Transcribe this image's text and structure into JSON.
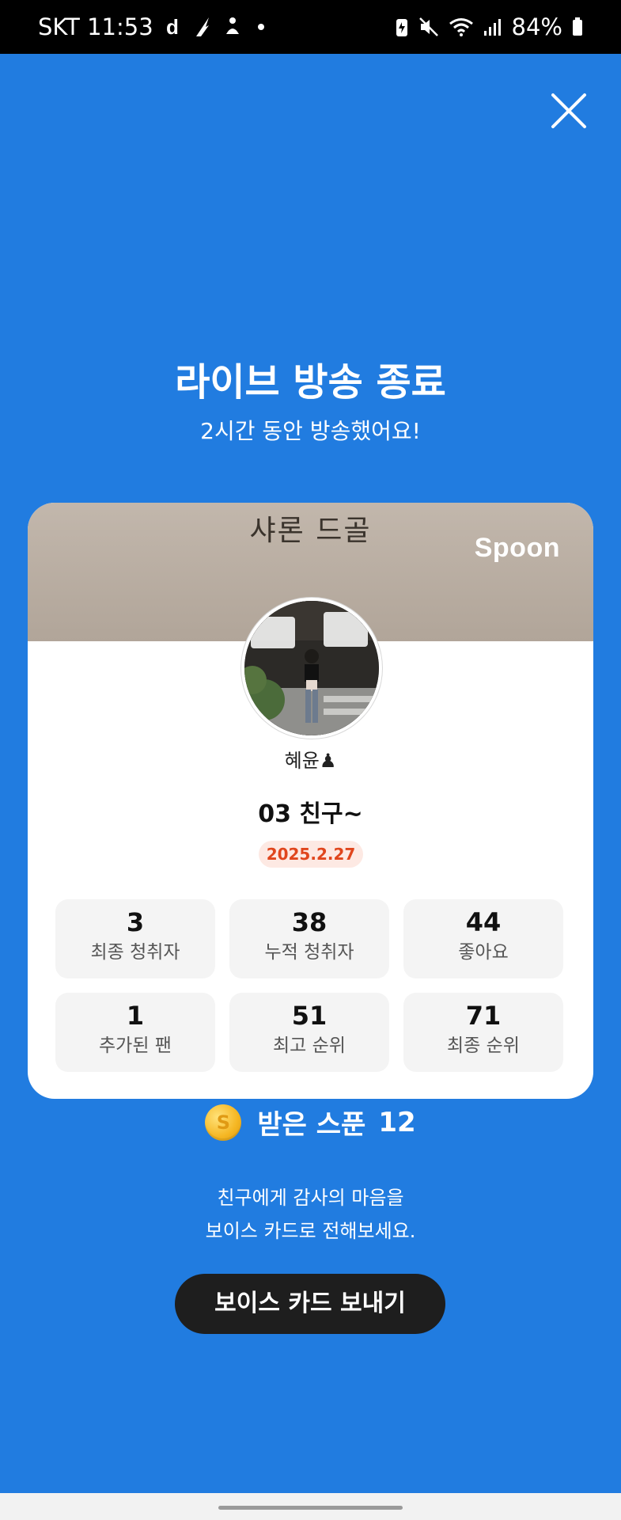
{
  "status_bar": {
    "carrier_time": "SKT 11:53",
    "battery": "84%",
    "icons_left": [
      "d-app-icon",
      "feather-app-icon",
      "meditation-app-icon",
      "notification-dot"
    ],
    "icons_right": [
      "battery-saver-icon",
      "mute-icon",
      "wifi-icon",
      "signal-icon",
      "battery-icon"
    ]
  },
  "header": {
    "title": "라이브 방송 종료",
    "subtitle": "2시간 동안 방송했어요!"
  },
  "card": {
    "banner_text": "샤론 드골",
    "brand": "Spoon",
    "user_name": "혜윤♟",
    "room_title": "03 친구~",
    "date": "2025.2.27",
    "stats": [
      {
        "value": "3",
        "label": "최종 청취자"
      },
      {
        "value": "38",
        "label": "누적 청취자"
      },
      {
        "value": "44",
        "label": "좋아요"
      },
      {
        "value": "1",
        "label": "추가된 팬"
      },
      {
        "value": "51",
        "label": "최고 순위"
      },
      {
        "value": "71",
        "label": "최종 순위"
      }
    ]
  },
  "spoon": {
    "coin_symbol": "S",
    "label": "받은 스푼",
    "count": "12"
  },
  "message": {
    "line1": "친구에게 감사의 마음을",
    "line2": "보이스 카드로 전해보세요."
  },
  "button": {
    "label": "보이스 카드 보내기"
  },
  "colors": {
    "background": "#217ce0",
    "date_badge_text": "#e0461d",
    "date_badge_bg": "#fde9e3",
    "button_bg": "#1e1e1e"
  }
}
